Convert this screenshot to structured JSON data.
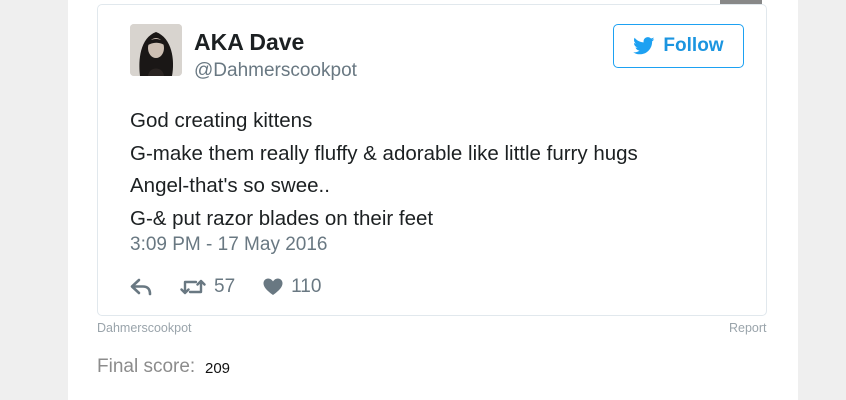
{
  "tweet": {
    "author_name": "AKA Dave",
    "handle": "@Dahmerscookpot",
    "follow_label": "Follow",
    "lines": [
      "God creating kittens",
      "G-make them really fluffy & adorable like little furry hugs",
      "Angel-that's so swee..",
      "G-& put razor blades on their feet"
    ],
    "timestamp": "3:09 PM - 17 May 2016",
    "retweet_count": "57",
    "like_count": "110"
  },
  "footer": {
    "source": "Dahmerscookpot",
    "report_label": "Report"
  },
  "score": {
    "label": "Final score:",
    "value": "209"
  },
  "colors": {
    "twitter_blue": "#1da1f2",
    "text_primary": "#1c2022",
    "text_secondary": "#697882"
  },
  "icons": {
    "share": "share-arrow-icon",
    "follow": "twitter-bird-icon",
    "reply": "reply-icon",
    "retweet": "retweet-icon",
    "like": "heart-icon"
  }
}
